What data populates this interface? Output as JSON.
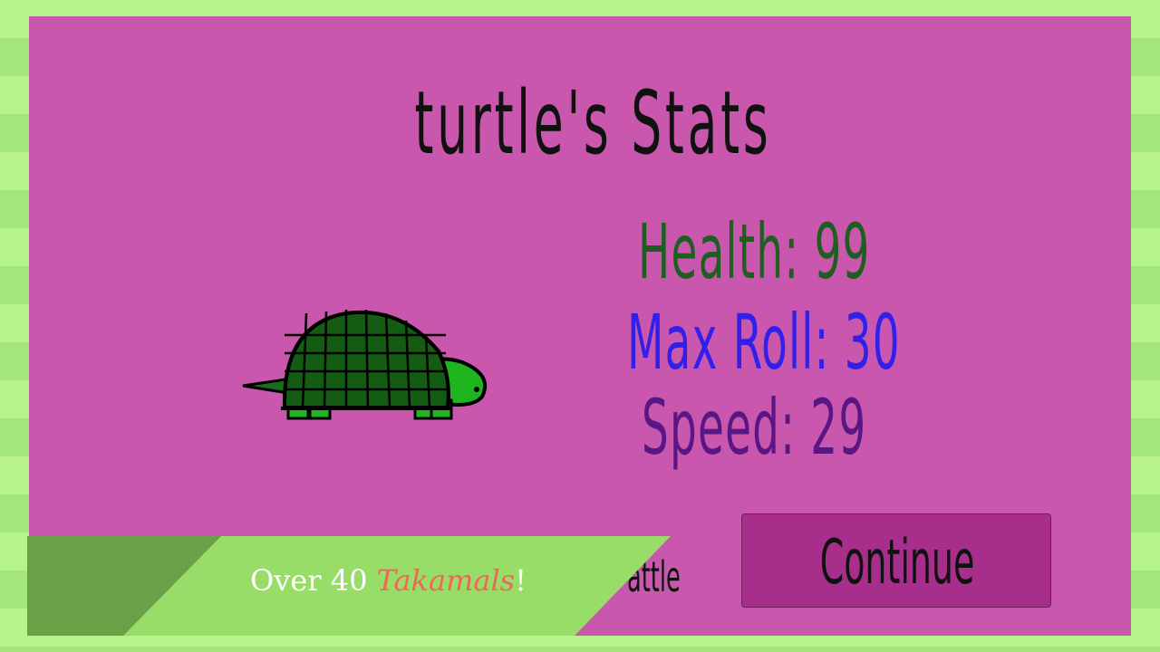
{
  "screen": {
    "title": "turtle's Stats"
  },
  "pet": {
    "name": "turtle",
    "image_icon": "turtle-sprite"
  },
  "stats": {
    "health": "Health: 99",
    "max_roll": "Max Roll: 30",
    "speed": "Speed: 29"
  },
  "buttons": {
    "continue_label": "Continue",
    "partial_hidden_label": "attle"
  },
  "banner": {
    "text_prefix": "Over 40 ",
    "text_highlight": "Takamals",
    "text_suffix": "!"
  },
  "colors": {
    "panel_bg": "#c957ad",
    "stripe_light": "#b6f48a",
    "stripe_dark": "#a4e77a",
    "health": "#1e5f21",
    "max_roll": "#3320e8",
    "speed": "#5a1684",
    "continue_bg": "#a72f8b",
    "banner_light": "#98dd68",
    "banner_dark": "#6aa046",
    "banner_highlight": "#ec6a55"
  }
}
